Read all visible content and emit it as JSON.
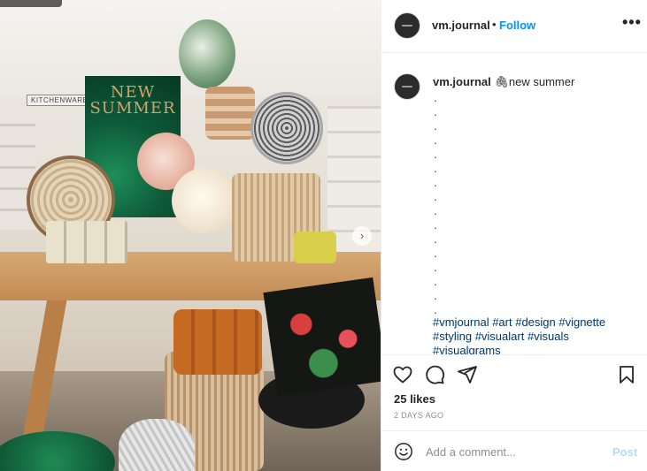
{
  "post": {
    "username": "vm.journal",
    "separator": "•",
    "follow_label": "Follow",
    "more_label": "•••"
  },
  "photo": {
    "sign_text": "KITCHENWARE",
    "poster_text": "NEW SUMMER",
    "next_arrow": "›"
  },
  "caption": {
    "username": "vm.journal",
    "emoji": "🖇",
    "text": "new summer",
    "dots": [
      ".",
      ".",
      ".",
      ".",
      ".",
      ".",
      ".",
      ".",
      ".",
      ".",
      ".",
      ".",
      ".",
      ".",
      ".",
      "."
    ],
    "hashtags": "#vmjournal #art #design #vignette #styling #visualart #visuals #visualgrams"
  },
  "engagement": {
    "likes": "25 likes",
    "timestamp": "2 DAYS AGO"
  },
  "comment": {
    "placeholder": "Add a comment...",
    "post_label": "Post"
  },
  "colors": {
    "follow_blue": "#0095f6",
    "hashtag_blue": "#00376b",
    "post_disabled": "#b3dbff"
  },
  "icons": {
    "like": "heart-icon",
    "comment": "comment-icon",
    "share": "share-icon",
    "save": "bookmark-icon",
    "emoji": "smile-icon"
  }
}
